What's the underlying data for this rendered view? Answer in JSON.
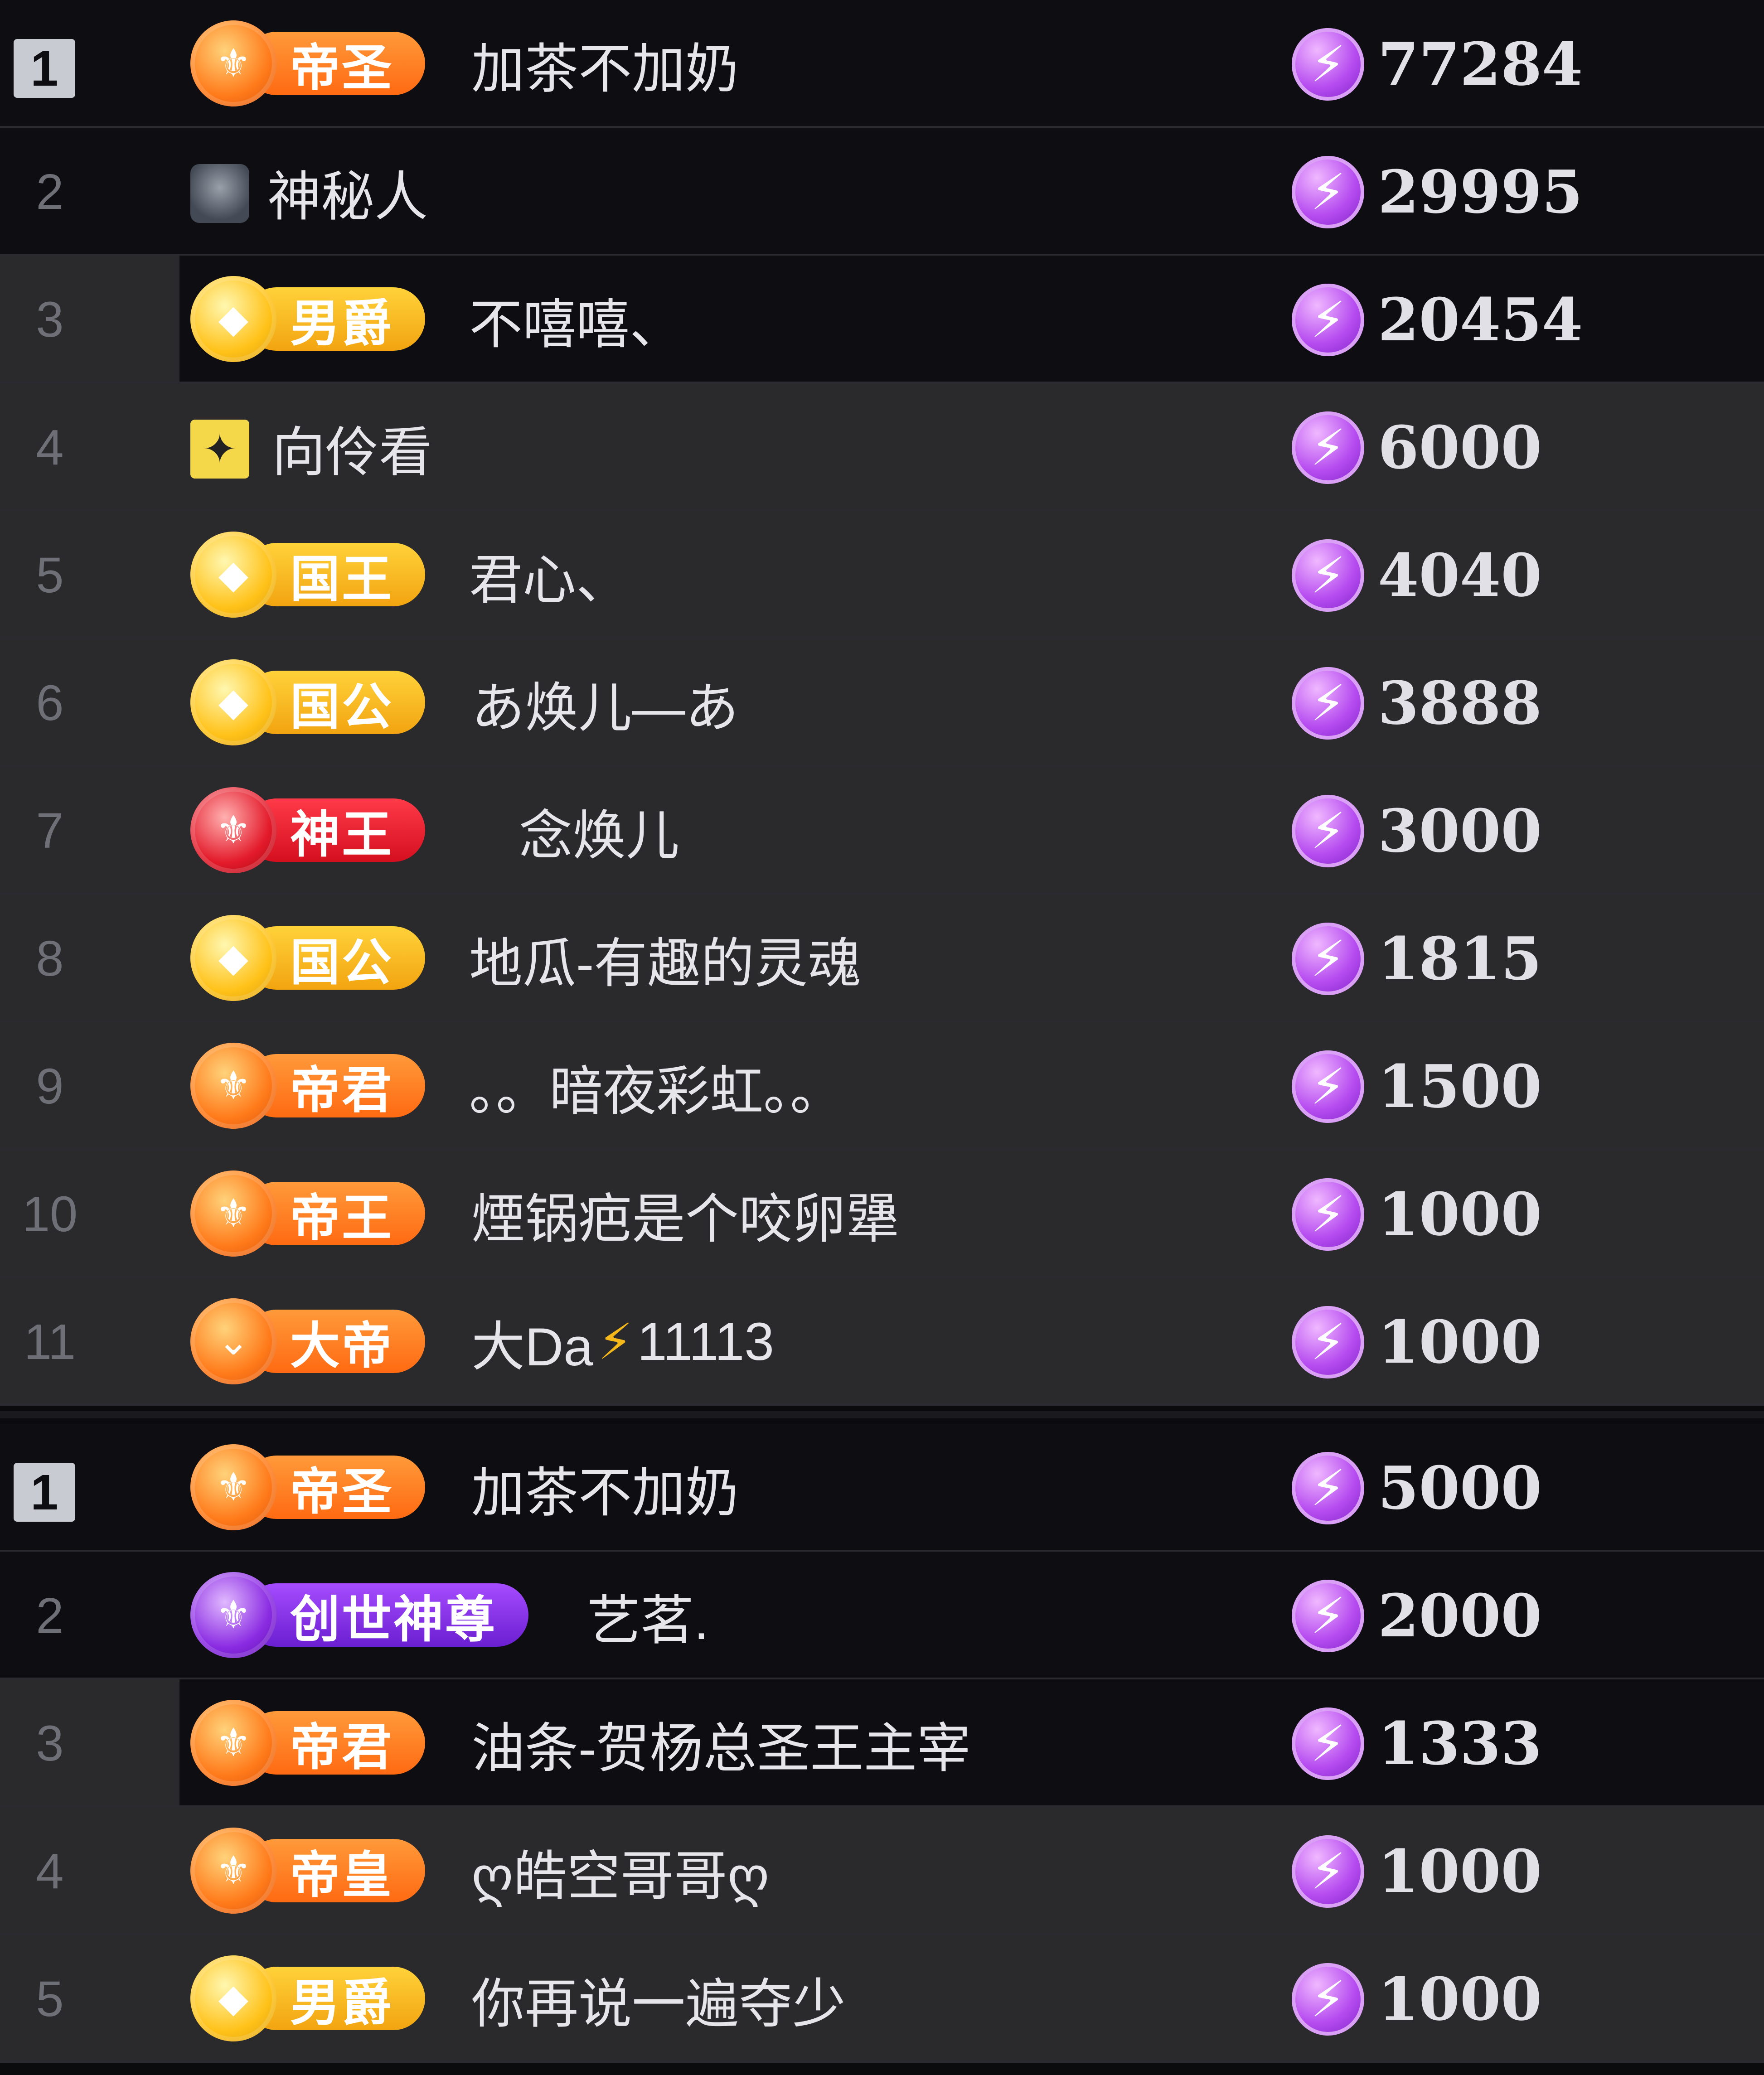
{
  "section1": [
    {
      "rank": "1",
      "badge": "帝圣",
      "badge_style": "orange",
      "emblem": "⚜",
      "name": "加茶不加奶",
      "score": "77284"
    },
    {
      "rank": "2",
      "badge": "",
      "avatar": "mystery",
      "name": "神秘人",
      "score": "29995"
    },
    {
      "rank": "3",
      "badge": "男爵",
      "badge_style": "gold",
      "emblem": "◆",
      "name": "不嘻嘻、",
      "score": "20454"
    },
    {
      "rank": "4",
      "badge": "",
      "avatar": "yellow",
      "name": "向伶看",
      "score": "6000"
    },
    {
      "rank": "5",
      "badge": "国王",
      "badge_style": "gold",
      "emblem": "◆",
      "name": "君心、",
      "score": "4040"
    },
    {
      "rank": "6",
      "badge": "国公",
      "badge_style": "gold",
      "emblem": "◆",
      "name": "あ焕儿—あ",
      "score": "3888"
    },
    {
      "rank": "7",
      "badge": "神王",
      "badge_style": "red",
      "emblem": "⚜",
      "name": "念焕儿",
      "score": "3000"
    },
    {
      "rank": "8",
      "badge": "国公",
      "badge_style": "gold",
      "emblem": "◆",
      "name": "地瓜-有趣的灵魂",
      "score": "1815"
    },
    {
      "rank": "9",
      "badge": "帝君",
      "badge_style": "orange",
      "emblem": "⚜",
      "name": "。。暗夜彩虹。。",
      "score": "1500"
    },
    {
      "rank": "10",
      "badge": "帝王",
      "badge_style": "orange",
      "emblem": "⚜",
      "name": "煙锅疤是个咬卵犟",
      "score": "1000"
    },
    {
      "rank": "11",
      "badge": "大帝",
      "badge_style": "orange",
      "emblem": "⌄",
      "name": "大Da",
      "name_suffix": "11113",
      "score": "1000"
    }
  ],
  "section2": [
    {
      "rank": "1",
      "badge": "帝圣",
      "badge_style": "orange",
      "emblem": "⚜",
      "name": "加茶不加奶",
      "score": "5000"
    },
    {
      "rank": "2",
      "badge": "创世神尊",
      "badge_style": "purple",
      "emblem": "⚜",
      "name": "艺茗.",
      "score": "2000"
    },
    {
      "rank": "3",
      "badge": "帝君",
      "badge_style": "orange",
      "emblem": "⚜",
      "name": "油条-贺杨总圣王主宰",
      "score": "1333"
    },
    {
      "rank": "4",
      "badge": "帝皇",
      "badge_style": "orange",
      "emblem": "⚜",
      "name": "ღ皓空哥哥ღ",
      "score": "1000"
    },
    {
      "rank": "5",
      "badge": "男爵",
      "badge_style": "gold",
      "emblem": "◆",
      "name": "你再说一遍夺少",
      "score": "1000"
    }
  ],
  "icons": {
    "coin": "lightning-coin-icon",
    "bolt": "⚡"
  },
  "colors": {
    "dark_row": "#0e0d12",
    "gray_row": "#2a2a2c",
    "coin_purple": "#b64cf0",
    "orange_badge": "#ff7a1a",
    "gold_badge": "#f2a410",
    "red_badge": "#d40f1f",
    "purple_badge": "#8a2be2"
  }
}
